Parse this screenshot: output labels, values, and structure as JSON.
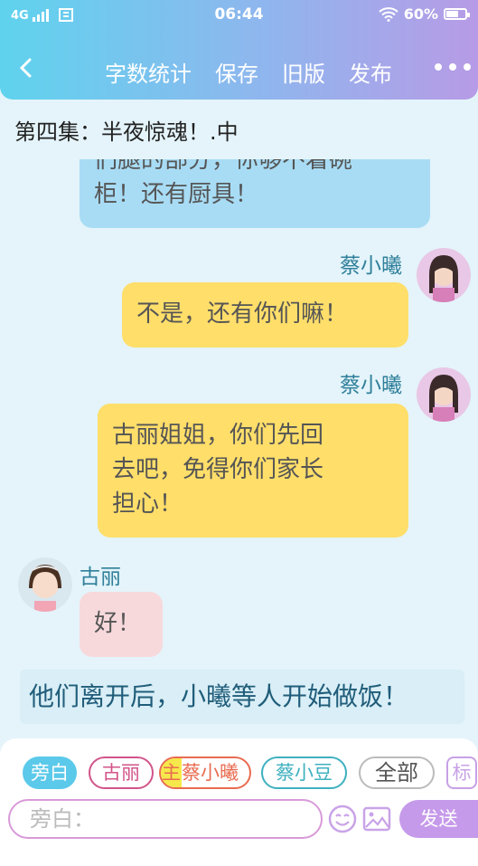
{
  "status_bar": {
    "network": "4G",
    "time": "06:44",
    "battery": "60%"
  },
  "navbar": {
    "items": [
      "字数统计",
      "保存",
      "旧版",
      "发布"
    ]
  },
  "episode_title": "第四集：半夜惊魂！.中",
  "chat": {
    "partial_message": {
      "line1": "们腿的部分，你够不着碗",
      "line2": "柜！还有厨具！"
    },
    "messages": [
      {
        "speaker": "蔡小曦",
        "lines": [
          "不是，还有你们嘛！"
        ]
      },
      {
        "speaker": "蔡小曦",
        "lines": [
          "古丽姐姐，你们先回",
          "去吧，免得你们家长",
          "担心！"
        ]
      },
      {
        "speaker": "古丽",
        "lines": [
          "好！"
        ]
      }
    ],
    "narration": "他们离开后，小曦等人开始做饭！"
  },
  "role_chips": {
    "narrator": "旁白",
    "guli": "古丽",
    "main_tag": "主",
    "caixiaoxi": "蔡小曦",
    "caixiaodou": "蔡小豆",
    "all": "全部",
    "tag": "标"
  },
  "input": {
    "placeholder": "旁白："
  },
  "send_label": "发送",
  "colors": {
    "accent_blue": "#5bc9ea",
    "accent_purple": "#c69aea",
    "bubble_yellow": "#ffde6a",
    "bubble_blue": "#a8dcf5",
    "bubble_pink": "#f7d9dc"
  }
}
